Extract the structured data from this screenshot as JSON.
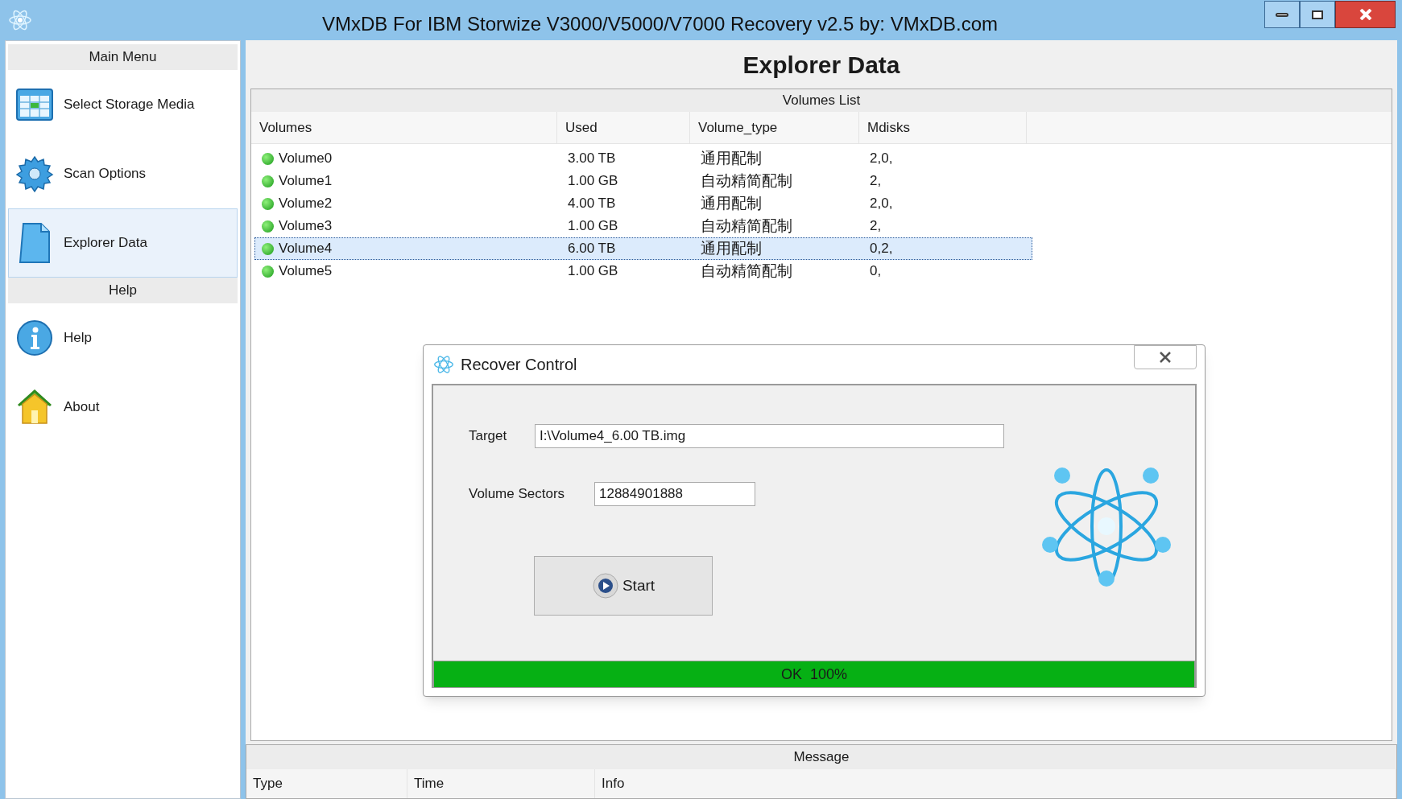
{
  "window": {
    "title": "VMxDB For IBM Storwize V3000/V5000/V7000 Recovery v2.5 by: VMxDB.com"
  },
  "sidebar": {
    "sections": [
      {
        "title": "Main Menu",
        "items": [
          {
            "label": "Select Storage Media",
            "kind": "grid",
            "selected": false
          },
          {
            "label": "Scan Options",
            "kind": "gear",
            "selected": false
          },
          {
            "label": "Explorer Data",
            "kind": "page",
            "selected": true
          }
        ]
      },
      {
        "title": "Help",
        "items": [
          {
            "label": "Help",
            "kind": "info",
            "selected": false
          },
          {
            "label": "About",
            "kind": "house",
            "selected": false
          }
        ]
      }
    ]
  },
  "page_title": "Explorer Data",
  "volumes_list": {
    "title": "Volumes List",
    "columns": [
      "Volumes",
      "Used",
      "Volume_type",
      "Mdisks"
    ],
    "rows": [
      {
        "cells": [
          "Volume0",
          "3.00 TB",
          "通用配制",
          "2,0,"
        ],
        "selected": false
      },
      {
        "cells": [
          "Volume1",
          "1.00 GB",
          "自动精简配制",
          "2,"
        ],
        "selected": false
      },
      {
        "cells": [
          "Volume2",
          "4.00 TB",
          "通用配制",
          "2,0,"
        ],
        "selected": false
      },
      {
        "cells": [
          "Volume3",
          "1.00 GB",
          "自动精简配制",
          "2,"
        ],
        "selected": false
      },
      {
        "cells": [
          "Volume4",
          "6.00 TB",
          "通用配制",
          "0,2,"
        ],
        "selected": true
      },
      {
        "cells": [
          "Volume5",
          "1.00 GB",
          "自动精简配制",
          "0,"
        ],
        "selected": false
      }
    ]
  },
  "dialog": {
    "title": "Recover Control",
    "fields": [
      {
        "label": "Target",
        "value": "I:\\Volume4_6.00 TB.img"
      },
      {
        "label": "Volume Sectors",
        "value": "12884901888"
      }
    ],
    "button": "Start",
    "progress": {
      "level": 1,
      "text": "OK  100%"
    }
  },
  "message": {
    "title": "Message",
    "columns": [
      "Type",
      "Time",
      "Info"
    ]
  }
}
